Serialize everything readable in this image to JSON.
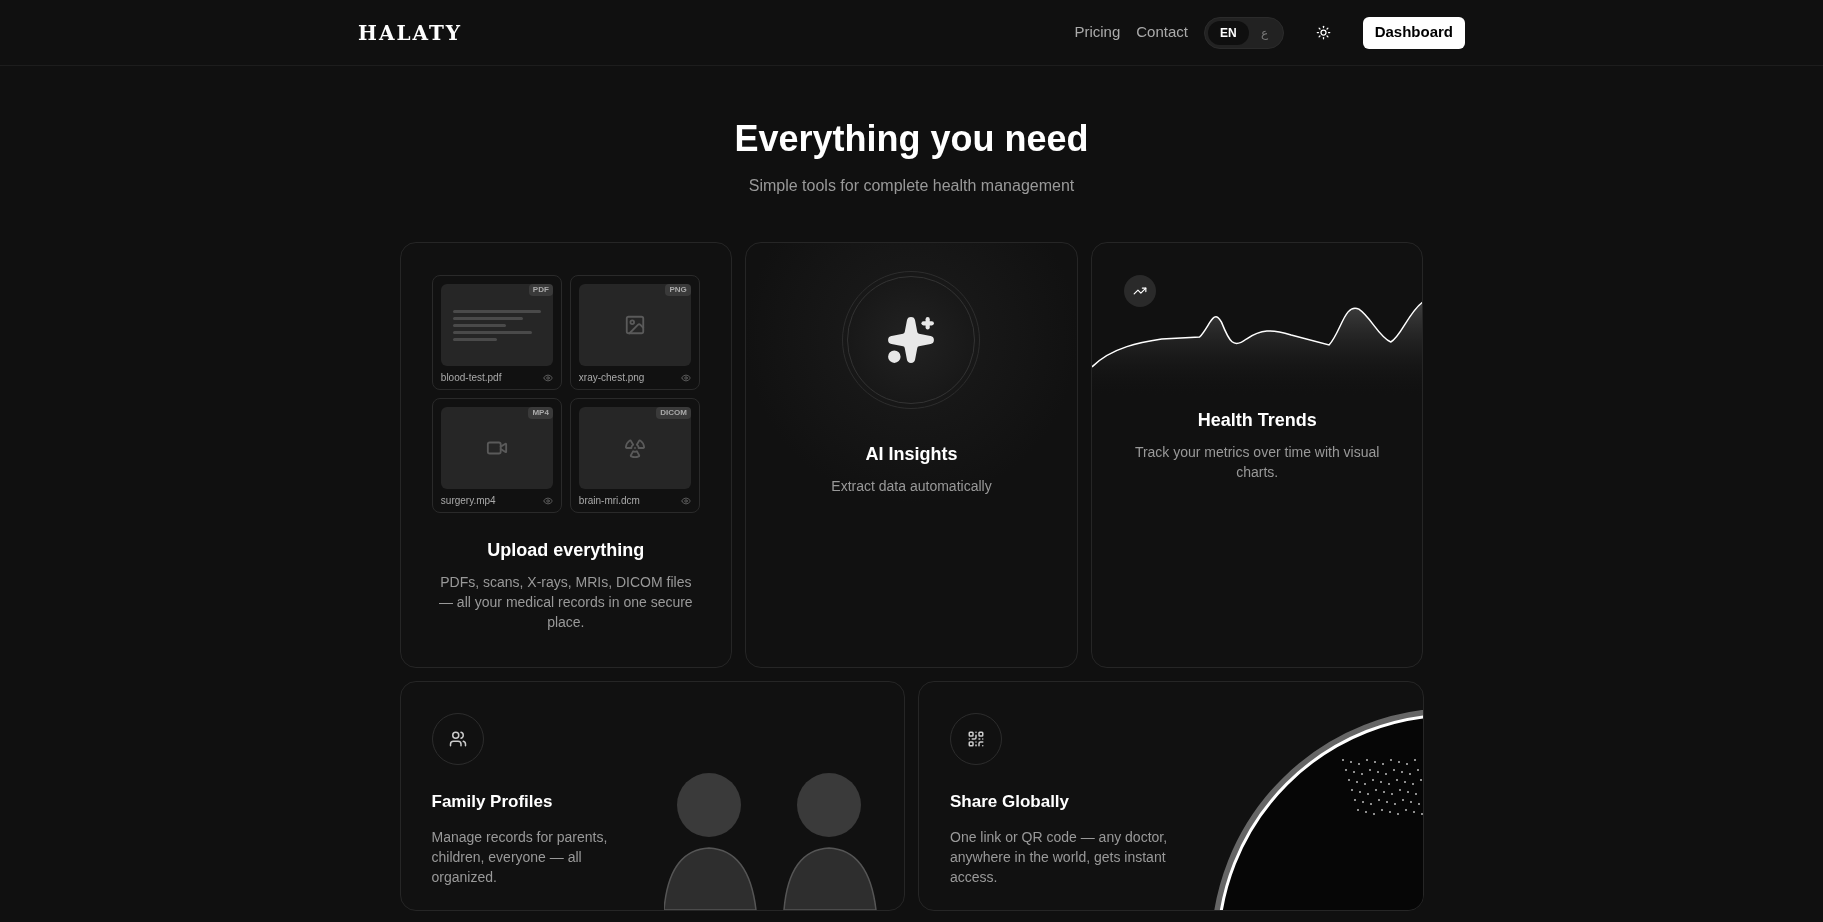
{
  "header": {
    "logo": "HALATY",
    "nav": [
      "Pricing",
      "Contact"
    ],
    "languages": [
      {
        "label": "EN",
        "selected": true
      },
      {
        "label": "ع",
        "selected": false
      }
    ],
    "cta": "Dashboard"
  },
  "hero": {
    "title": "Everything you need",
    "subtitle": "Simple tools for complete health management"
  },
  "upload_card": {
    "files": [
      {
        "name": "blood-test.pdf",
        "badge": "PDF",
        "kind": "document"
      },
      {
        "name": "xray-chest.png",
        "badge": "PNG",
        "kind": "image"
      },
      {
        "name": "surgery.mp4",
        "badge": "MP4",
        "kind": "video"
      },
      {
        "name": "brain-mri.dcm",
        "badge": "DICOM",
        "kind": "scan"
      }
    ],
    "title": "Upload everything",
    "description": "PDFs, scans, X-rays, MRIs, DICOM files — all your medical records in one secure place."
  },
  "ai_card": {
    "title": "AI Insights",
    "description": "Extract data automatically"
  },
  "trends_card": {
    "title": "Health Trends",
    "description": "Track your metrics over time with visual charts."
  },
  "family_card": {
    "title": "Family Profiles",
    "description": "Manage records for parents, children, everyone — all organized."
  },
  "share_card": {
    "title": "Share Globally",
    "description": "One link or QR code — any doctor, anywhere in the world, gets instant access."
  }
}
